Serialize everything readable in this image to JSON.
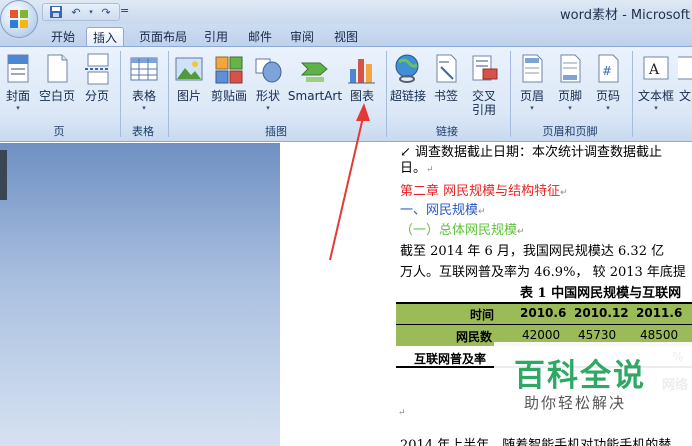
{
  "window": {
    "title": "word素材 - Microsoft W"
  },
  "quick_access": {
    "save_icon": "save-icon",
    "undo_icon": "undo-icon",
    "redo_icon": "redo-icon",
    "more": "="
  },
  "tabs": [
    {
      "label": "开始"
    },
    {
      "label": "插入"
    },
    {
      "label": "页面布局"
    },
    {
      "label": "引用"
    },
    {
      "label": "邮件"
    },
    {
      "label": "审阅"
    },
    {
      "label": "视图"
    }
  ],
  "ribbon": {
    "buttons": {
      "cover": "封面",
      "blank_page": "空白页",
      "page_break": "分页",
      "table": "表格",
      "picture": "图片",
      "clipart": "剪贴画",
      "shapes": "形状",
      "smartart": "SmartArt",
      "chart": "图表",
      "hyperlink": "超链接",
      "bookmark": "书签",
      "crossref_1": "交叉",
      "crossref_2": "引用",
      "header": "页眉",
      "footer": "页脚",
      "page_number": "页码",
      "textbox": "文本框",
      "text_partial": "文"
    },
    "groups": {
      "pages": "页",
      "tables": "表格",
      "illustrations": "插图",
      "links": "链接",
      "header_footer": "页眉和页脚"
    }
  },
  "document": {
    "line1": "调查数据截止日期：本次统计调查数据截止",
    "line2": "日。",
    "chapter": "第二章  网民规模与结构特征",
    "section1": "一、网民规模",
    "subsection1": "（一）总体网民规模",
    "para1": "截至 2014 年 6 月，我国网民规模达 6.32 亿",
    "para2": "万人。互联网普及率为 46.9%， 较 2013 年底提",
    "table_title": "表 1  中国网民规模与互联网",
    "table": {
      "header": [
        "时间",
        "2010.6",
        "2010.12",
        "2011.6"
      ],
      "row1": [
        "网民数",
        "42000",
        "45730",
        "48500"
      ],
      "row2_label": "互联网普及率",
      "row2_tail": "%"
    },
    "after_table": "网络",
    "final_line": "2014 年上半年，随着智能手机对功能手机的替"
  },
  "watermark": {
    "title": "百科全说",
    "subtitle": "助你轻松解决"
  },
  "colors": {
    "accent_green": "#9bbb59",
    "heading_red": "#e42525",
    "heading_blue": "#2a58c9",
    "heading_green": "#5fc23a",
    "annotation": "#e53935"
  }
}
